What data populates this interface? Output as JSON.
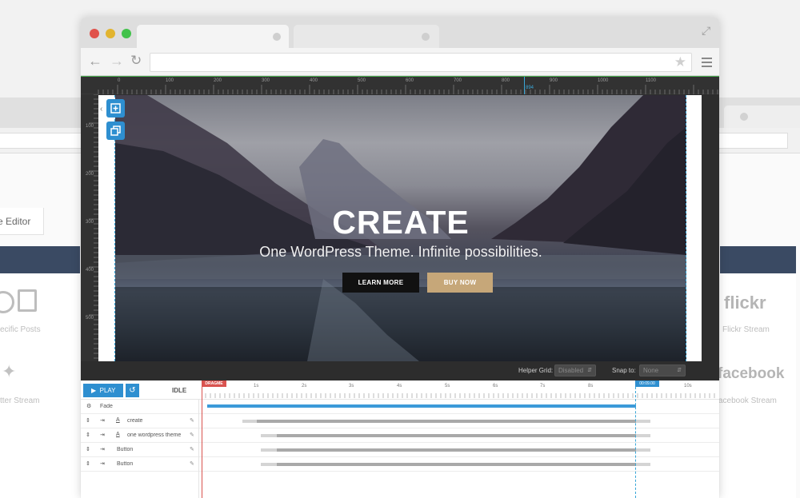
{
  "background_window": {
    "editor_tab_label": "e Editor",
    "specific_posts_label": "ecific Posts",
    "twitter_stream_label": "tter Stream",
    "flickr_brand": "flickr",
    "flickr_stream_label": "Flickr Stream",
    "facebook_brand": "facebook",
    "facebook_stream_label": "acebook Stream"
  },
  "editor": {
    "ruler_top_labels": [
      "0",
      "100",
      "200",
      "300",
      "400",
      "500",
      "600",
      "700",
      "800",
      "900",
      "1000",
      "1100"
    ],
    "ruler_cursor_label": "894",
    "ruler_left_labels": [
      "100",
      "200",
      "300",
      "400",
      "500"
    ],
    "hero": {
      "title": "CREATE",
      "subtitle": "One WordPress Theme. Infinite possibilities.",
      "learn_more_label": "LEARN MORE",
      "buy_now_label": "BUY NOW"
    },
    "helper_grid_label": "Helper Grid:",
    "helper_grid_value": "Disabled",
    "snap_to_label": "Snap to:",
    "snap_to_value": "None"
  },
  "timeline": {
    "play_label": "PLAY",
    "status": "IDLE",
    "dragme_label": "DRAGME",
    "end_time_label": "00:09.00",
    "time_ticks": [
      "1s",
      "2s",
      "3s",
      "4s",
      "5s",
      "6s",
      "7s",
      "8s",
      "10s"
    ],
    "rows": [
      {
        "name": "Fade"
      },
      {
        "name": "create"
      },
      {
        "name": "one wordpress theme"
      },
      {
        "name": "Button"
      },
      {
        "name": "Button"
      }
    ],
    "colors": {
      "accent": "#2e8fd0",
      "drag": "#d9534f",
      "bar_gray": "#a9a9a9"
    }
  }
}
